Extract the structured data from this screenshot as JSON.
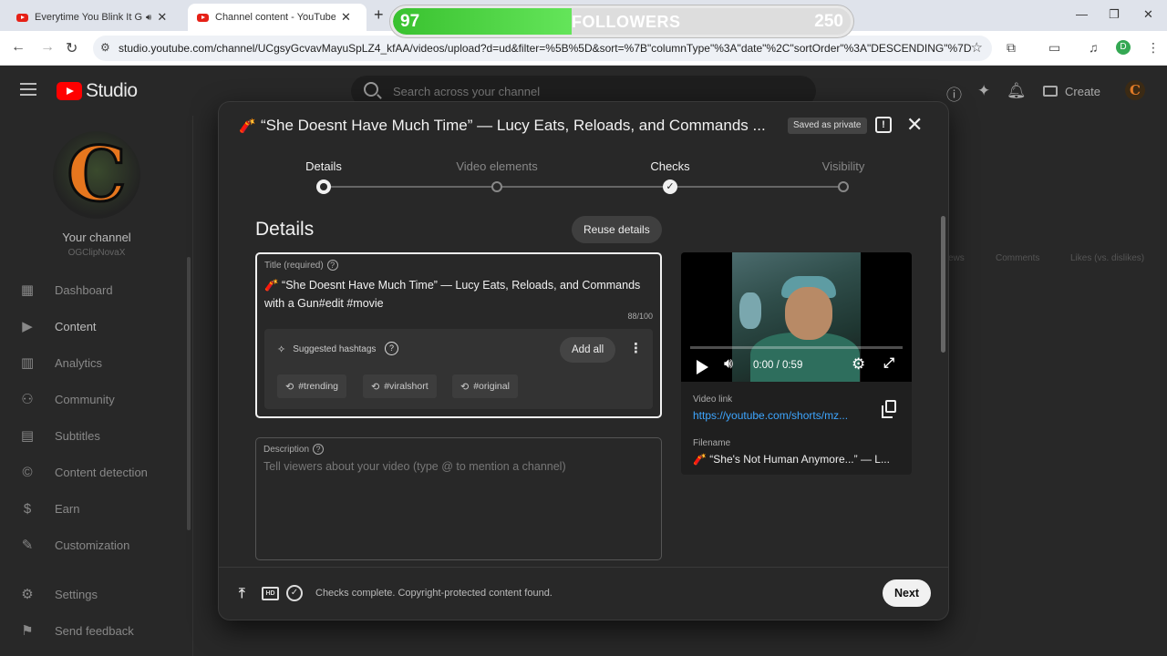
{
  "browser": {
    "tabs": [
      {
        "title": "Everytime You Blink It Gets ("
      },
      {
        "title": "Channel content - YouTube Stu"
      }
    ],
    "url": "studio.youtube.com/channel/UCgsyGcvavMayuSpLZ4_kfAA/videos/upload?d=ud&filter=%5B%5D&sort=%7B\"columnType\"%3A\"date\"%2C\"sortOrder\"%3A\"DESCENDING\"%7D",
    "profile_initial": "D"
  },
  "followers_overlay": {
    "current": "97",
    "label": "FOLLOWERS",
    "goal": "250",
    "progress": 0.39
  },
  "studio": {
    "logo_text": "Studio",
    "search_placeholder": "Search across your channel",
    "create_label": "Create",
    "avatar_letter": "C"
  },
  "sidebar": {
    "avatar_letter": "C",
    "your_channel": "Your channel",
    "channel_name": "OGClipNovaX",
    "items": [
      {
        "label": "Dashboard",
        "icon": "dashboard-icon"
      },
      {
        "label": "Content",
        "icon": "content-icon"
      },
      {
        "label": "Analytics",
        "icon": "analytics-icon"
      },
      {
        "label": "Community",
        "icon": "community-icon"
      },
      {
        "label": "Subtitles",
        "icon": "subtitles-icon"
      },
      {
        "label": "Content detection",
        "icon": "copyright-icon"
      },
      {
        "label": "Earn",
        "icon": "dollar-icon"
      },
      {
        "label": "Customization",
        "icon": "customization-icon"
      },
      {
        "label": "Settings",
        "icon": "gear-icon"
      },
      {
        "label": "Send feedback",
        "icon": "feedback-icon"
      }
    ]
  },
  "background_columns": {
    "views": "ews",
    "comments": "Comments",
    "likes": "Likes (vs. dislikes)"
  },
  "modal": {
    "title": "“She Doesnt Have Much Time” — Lucy Eats, Reloads, and Commands ...",
    "saved_badge": "Saved as private",
    "steps": [
      {
        "label": "Details",
        "state": "current"
      },
      {
        "label": "Video elements",
        "state": "pending"
      },
      {
        "label": "Checks",
        "state": "done"
      },
      {
        "label": "Visibility",
        "state": "pending"
      }
    ],
    "section_title": "Details",
    "reuse_label": "Reuse details",
    "title_field": {
      "label": "Title (required)",
      "value": "“She Doesnt Have Much Time” — Lucy Eats, Reloads, and Commands with a Gun#edit #movie",
      "count": "88/100"
    },
    "hashtags": {
      "title": "Suggested hashtags",
      "add_all": "Add all",
      "chips": [
        "#trending",
        "#viralshort",
        "#original"
      ]
    },
    "description": {
      "label": "Description",
      "placeholder": "Tell viewers about your video (type @ to mention a channel)"
    },
    "preview": {
      "time": "0:00 / 0:59",
      "progress": 0.0,
      "video_link_label": "Video link",
      "video_link": "https://youtube.com/shorts/mz...",
      "filename_label": "Filename",
      "filename": "“She's Not Human Anymore...” — L..."
    },
    "footer": {
      "status": "Checks complete. Copyright-protected content found.",
      "next_label": "Next"
    }
  }
}
